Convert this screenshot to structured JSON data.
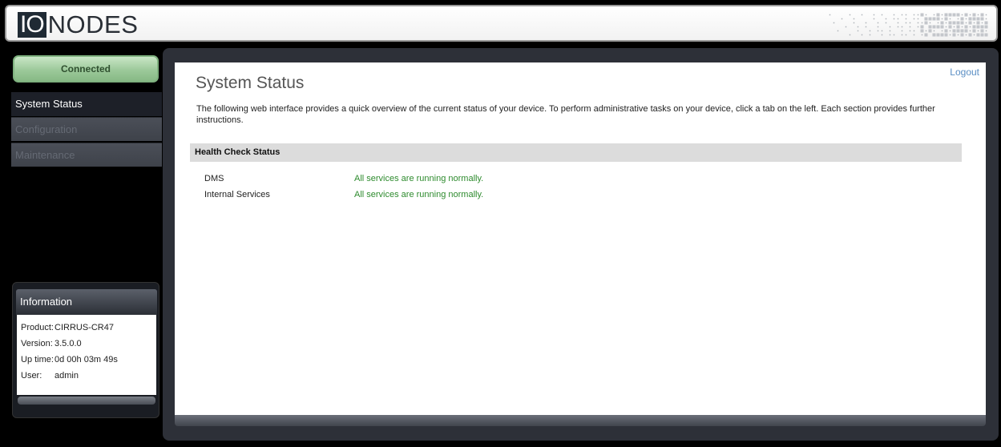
{
  "header": {
    "logo_box": "IO",
    "logo_rest": "NODES"
  },
  "sidebar": {
    "status_label": "Connected",
    "items": [
      {
        "label": "System Status",
        "active": true
      },
      {
        "label": "Configuration",
        "active": false
      },
      {
        "label": "Maintenance",
        "active": false
      }
    ]
  },
  "info": {
    "title": "Information",
    "rows": [
      {
        "key": "Product:",
        "value": "CIRRUS-CR47"
      },
      {
        "key": "Version:",
        "value": "3.5.0.0"
      },
      {
        "key": "Up time:",
        "value": "0d 00h 03m 49s"
      },
      {
        "key": "User:",
        "value": "admin"
      }
    ]
  },
  "main": {
    "logout_label": "Logout",
    "title": "System Status",
    "intro": "The following web interface provides a quick overview of the current status of your device.  To perform administrative tasks on your device, click a tab on the left.  Each section provides further instructions.",
    "health": {
      "title": "Health Check Status",
      "rows": [
        {
          "name": "DMS",
          "status": "All services are running normally."
        },
        {
          "name": "Internal Services",
          "status": "All services are running normally."
        }
      ]
    }
  },
  "colors": {
    "status_ok": "#2e8b2e",
    "link": "#5a8ec4",
    "connected_green": "#9cc99a"
  }
}
